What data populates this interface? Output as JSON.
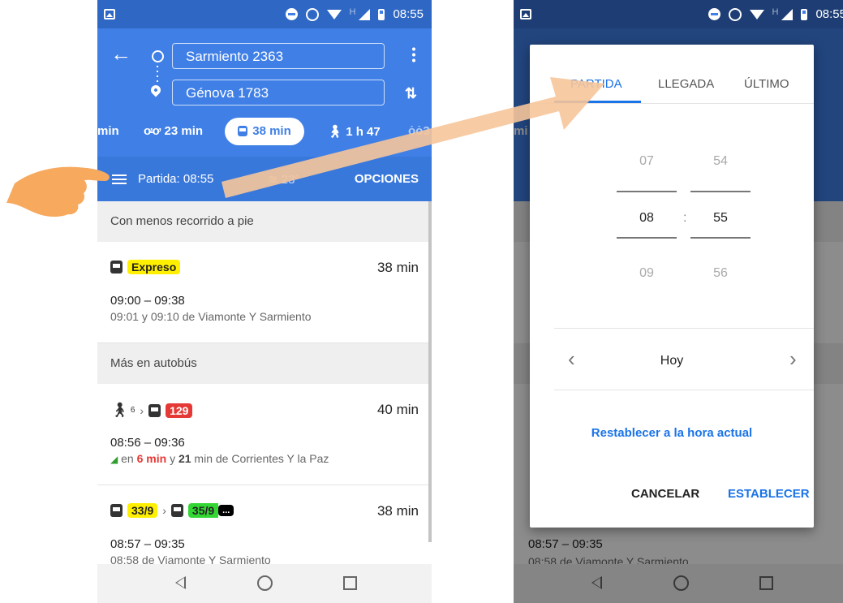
{
  "left": {
    "status": {
      "time": "08:55",
      "network_letter": "H"
    },
    "origin": "Sarmiento 2363",
    "destination": "Génova 1783",
    "modes": {
      "car": "min",
      "moto": "23 min",
      "transit": "38 min",
      "walk": "1 h 47",
      "bike": "3"
    },
    "options_bar": {
      "departure": "Partida: 08:55",
      "temperature": "23°",
      "options": "OPCIONES"
    },
    "sections": [
      {
        "header": "Con menos recorrido a pie"
      },
      {
        "header": "Más en autobús"
      }
    ],
    "routes": [
      {
        "badge": "Expreso",
        "badge_bg": "#ffef00",
        "duration": "38 min",
        "times": "09:00 – 09:38",
        "detail": "09:01 y 09:10 de Viamonte Y Sarmiento"
      },
      {
        "walk_minutes": "6",
        "badge": "129",
        "badge_bg": "#e53935",
        "duration": "40 min",
        "times": "08:56 – 09:36",
        "detail_pre": "en",
        "detail_red": "6 min",
        "detail_mid": "y",
        "detail_bold": "21",
        "detail_post": "min de Corrientes Y la Paz"
      },
      {
        "badge": "33/9",
        "badge_bg": "#ffef00",
        "badge2": "35/9",
        "badge2_bg": "#33d633",
        "badge3": "...",
        "duration": "38 min",
        "times": "08:57 – 09:35",
        "detail": "08:58 de Viamonte Y Sarmiento"
      }
    ]
  },
  "right": {
    "status": {
      "time": "08:55",
      "network_letter": "H"
    },
    "tabs": [
      "PARTIDA",
      "LLEGADA",
      "ÚLTIMO"
    ],
    "picker": {
      "hours": [
        "07",
        "08",
        "09"
      ],
      "minutes": [
        "54",
        "55",
        "56"
      ],
      "separator": ":"
    },
    "day": "Hoy",
    "reset": "Restablecer a la hora actual",
    "cancel": "CANCELAR",
    "set": "ESTABLECER",
    "under_times": "08:57 – 09:35",
    "under_detail": "08:58 de Viamonte Y Sarmiento",
    "under_mode": "mi"
  },
  "colors": {
    "maps_blue": "#3f7fe6",
    "accent": "#1a73e8",
    "arrow": "#f6c59a",
    "hand": "#f7a95e"
  }
}
